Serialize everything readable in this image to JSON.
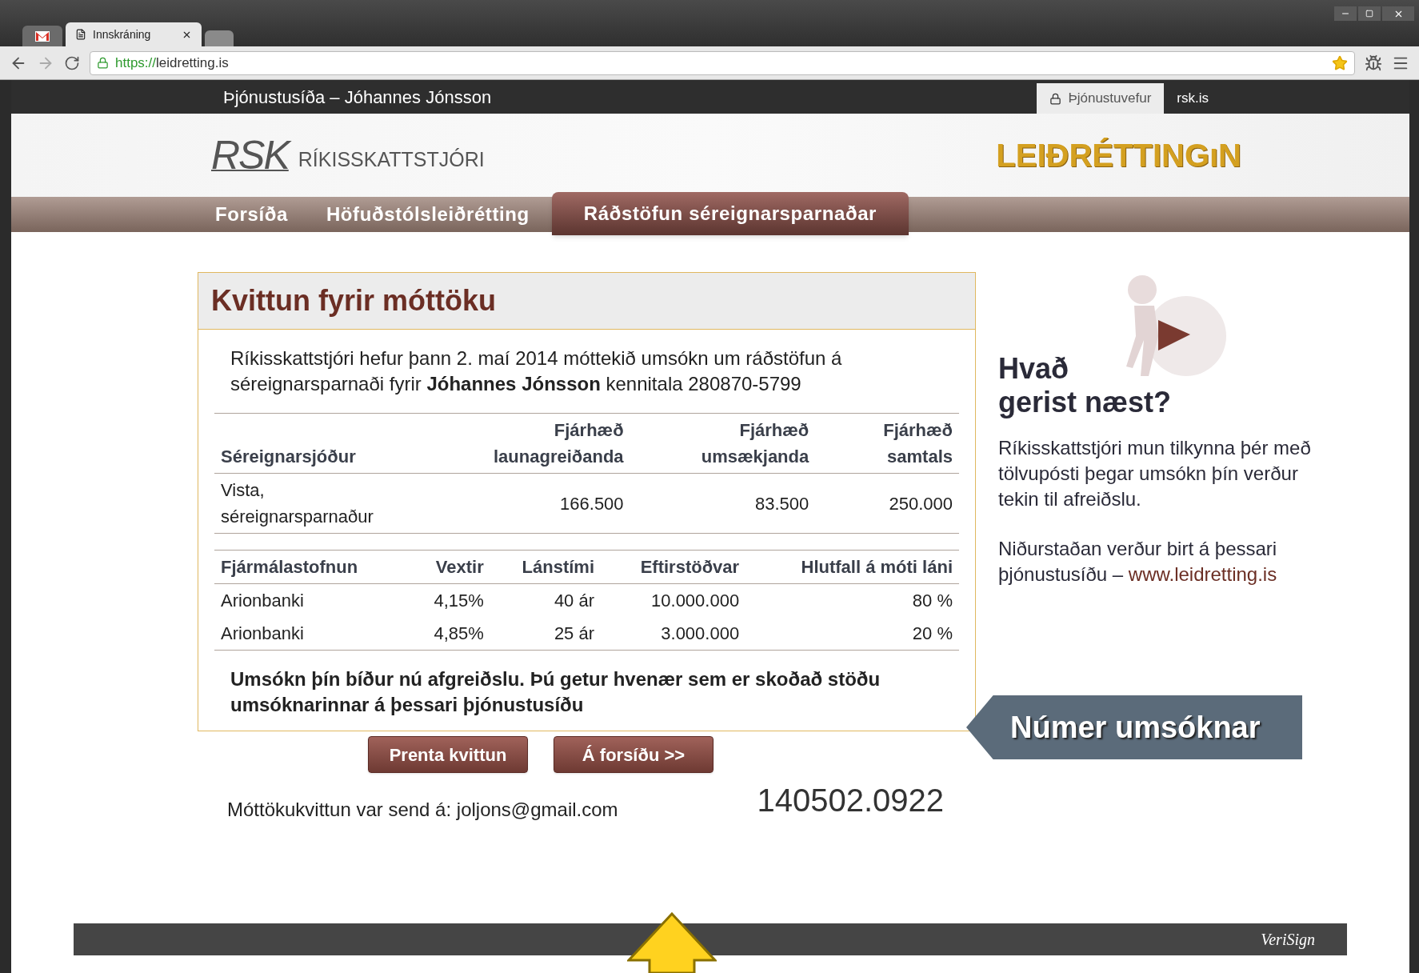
{
  "browser": {
    "tabs": [
      {
        "kind": "mail",
        "selected": false
      },
      {
        "kind": "page",
        "label": "Innskráning",
        "selected": true
      },
      {
        "kind": "new",
        "selected": false
      }
    ],
    "address": {
      "scheme": "https://",
      "host": "leidretting.is"
    }
  },
  "site_bar": {
    "title": "Þjónustusíða – Jóhannes Jónsson",
    "links": [
      {
        "label": "Þjónustuvefur",
        "selected": true,
        "locked": true
      },
      {
        "label": "rsk.is",
        "selected": false,
        "locked": false
      }
    ]
  },
  "header": {
    "logo_mark": "RSK",
    "logo_name": "RÍKISSKATTSTJÓRI",
    "brand": "LEIÐRÉTTINGıN"
  },
  "nav": [
    {
      "label": "Forsíða",
      "selected": false
    },
    {
      "label": "Höfuðstólsleiðrétting",
      "selected": false
    },
    {
      "label": "Ráðstöfun séreignarsparnaðar",
      "selected": true
    }
  ],
  "receipt": {
    "title": "Kvittun fyrir móttöku",
    "intro": "Ríkisskattstjóri hefur þann 2. maí 2014 móttekið umsókn um ráðstöfun á séreignarsparnaði fyrir **Jóhannes Jónsson** kennitala 280870-5799",
    "table_1": {
      "columns": [
        "Séreignarsjóður",
        "Fjárhæð launagreiðanda",
        "Fjárhæð umsækjanda",
        "Fjárhæð samtals"
      ],
      "rows": [
        [
          "Vista, séreignarsparnaður",
          "166.500",
          "83.500",
          "250.000"
        ]
      ]
    },
    "table_2": {
      "columns": [
        "Fjármálastofnun",
        "Vextir",
        "Lánstími",
        "Eftirstöðvar",
        "Hlutfall á móti láni"
      ],
      "rows": [
        [
          "Arionbanki",
          "4,15%",
          "40 ár",
          "10.000.000",
          "80 %"
        ],
        [
          "Arionbanki",
          "4,85%",
          "25 ár",
          "3.000.000",
          "20 %"
        ]
      ]
    },
    "notice": "Umsókn þín bíður nú afgreiðslu. Þú getur hvenær sem er skoðað stöðu umsóknarinnar á þessari þjónustusíðu"
  },
  "actions": {
    "buttons": [
      "Prenta kvittun",
      "Á forsíðu >>"
    ],
    "email_note": "Móttökukvittun var send á: joljons@gmail.com",
    "application_number": "140502.0922"
  },
  "sidebar": {
    "heading_lines": [
      "Hvað",
      "gerist næst?"
    ],
    "paragraphs": [
      {
        "text": "Ríkisskattstjóri mun tilkynna þér með tölvupósti þegar umsókn þín verður tekin til afreiðslu."
      },
      {
        "text": "Niðurstaðan verður birt á þessari þjónustusíðu – ",
        "link": "www.leidretting.is"
      }
    ],
    "banner": "Númer umsóknar"
  },
  "footer": {
    "brand": "VeriSign"
  }
}
